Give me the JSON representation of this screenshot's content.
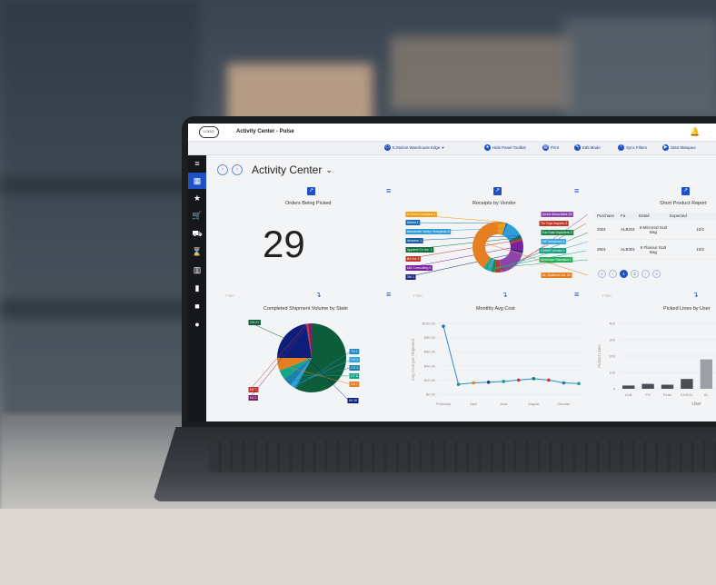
{
  "app": {
    "title": "Activity Center - Pulse",
    "logo_text": "LOGO"
  },
  "toolbar": {
    "warehouse": "K.Motion Warehouse Edge",
    "hide_panel": "Hide Panel Toolbar",
    "print": "Print",
    "edit_mode": "Edit Mode",
    "sync_filters": "Sync Filters",
    "start_marquee": "Start Marquee"
  },
  "page": {
    "title": "Activity Center"
  },
  "sidebar": {
    "icons": [
      "menu-icon",
      "grid-icon",
      "star-icon",
      "cart-icon",
      "truck-icon",
      "hourglass-icon",
      "barcode-icon",
      "bar-chart-icon",
      "briefcase-icon",
      "alert-icon"
    ]
  },
  "panels": {
    "orders": {
      "title": "Orders Being Picked",
      "value": "29"
    },
    "receipts": {
      "title": "Receipts by Vendor"
    },
    "short": {
      "title": "Short Product Report",
      "columns": [
        "Purchase",
        "Fa",
        "Detail",
        "Expected"
      ],
      "rows": [
        [
          "2001",
          "ALB201",
          "6-Mirrored SLB Bag",
          "10/2"
        ],
        [
          "3901",
          "ALB301",
          "6 Flavour SLB Bag",
          "10/2"
        ]
      ],
      "pages": [
        "1",
        "2"
      ]
    },
    "shipment": {
      "title": "Completed Shipment Volume by State"
    },
    "monthly": {
      "title": "Monthly Avg Cost",
      "ylabel": "Avg Cost per Shipment"
    },
    "picked": {
      "title": "Picked Lines by User",
      "xlabel": "User",
      "ylabel": "Picked Lines"
    },
    "filter_label": "Filter"
  },
  "chart_data": [
    {
      "type": "pie",
      "title": "Receipts by Vendor",
      "labels": [
        "A Good Company 4",
        "Alliant 1",
        "Alexander Valley Vineyards 8",
        "Amazon 1",
        "Apparel Co Inc. 1",
        "BA Inc 1",
        "AM Consulting 5",
        "3M 1",
        "Acme Associates 15",
        "Tin Toys Imports 3",
        "Far East Importers 2",
        "HF Industries 2",
        "CMWS Vendor 1",
        "American Standard 1",
        "AL Systems Ltd. 31"
      ],
      "values": [
        4,
        1,
        8,
        1,
        1,
        1,
        5,
        1,
        15,
        3,
        2,
        2,
        1,
        1,
        31
      ],
      "colors": [
        "#f39c12",
        "#1d6fb8",
        "#2f9ed8",
        "#1a5aa8",
        "#0f6e3a",
        "#c0392b",
        "#7b1fa2",
        "#1a237e",
        "#8e44ad",
        "#c0392b",
        "#1e8449",
        "#3aa5d9",
        "#16a085",
        "#27ae60",
        "#e67e22"
      ]
    },
    {
      "type": "pie",
      "title": "Completed Shipment Volume by State",
      "labels": [
        "OH 67",
        "TN 1",
        "CO 2",
        "CO 5",
        "CT 5",
        "CA 7",
        "MI 26",
        "NY 1",
        "NJ 2"
      ],
      "values": [
        67,
        1,
        2,
        5,
        5,
        7,
        26,
        1,
        2
      ],
      "colors": [
        "#0d5c3a",
        "#1e88c8",
        "#2aa3dc",
        "#1b7fb0",
        "#17a589",
        "#e67e22",
        "#0d1f7a",
        "#c0392b",
        "#7b1f6a"
      ]
    },
    {
      "type": "line",
      "title": "Monthly Avg Cost",
      "ylabel": "Avg Cost per Shipment",
      "categories": [
        "February",
        "March",
        "April",
        "May",
        "June",
        "July",
        "August",
        "September",
        "October",
        "November"
      ],
      "values": [
        96,
        14,
        16,
        17,
        18,
        20,
        22,
        20,
        16,
        15
      ],
      "yticks": [
        "$100.00",
        "$80.00",
        "$60.00",
        "$40.00",
        "$20.00",
        "$0.00"
      ],
      "xticks": [
        "February",
        "April",
        "June",
        "August",
        "October"
      ],
      "ylim": [
        0,
        100
      ]
    },
    {
      "type": "bar",
      "title": "Picked Lines by User",
      "xlabel": "User",
      "ylabel": "Picked Lines",
      "categories": [
        "ALB",
        "FH",
        "Peter",
        "KHSGL",
        "AL"
      ],
      "values": [
        20,
        30,
        25,
        60,
        180
      ],
      "yticks": [
        "400",
        "300",
        "200",
        "100",
        "0"
      ],
      "ylim": [
        0,
        400
      ]
    }
  ]
}
